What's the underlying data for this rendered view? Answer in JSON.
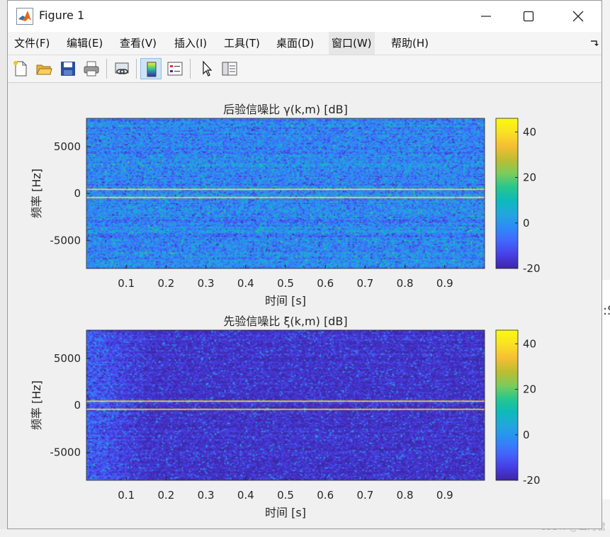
{
  "window": {
    "title": "Figure 1",
    "minimize_icon": "minimize-icon",
    "maximize_icon": "maximize-icon",
    "close_icon": "close-icon"
  },
  "menu": {
    "items": [
      {
        "label": "文件(F)"
      },
      {
        "label": "编辑(E)"
      },
      {
        "label": "查看(V)"
      },
      {
        "label": "插入(I)"
      },
      {
        "label": "工具(T)"
      },
      {
        "label": "桌面(D)"
      },
      {
        "label": "窗口(W)"
      },
      {
        "label": "帮助(H)"
      }
    ]
  },
  "toolbar": {
    "icons": [
      "new-figure-icon",
      "open-file-icon",
      "save-icon",
      "print-icon",
      "link-plot-icon",
      "colorbar-icon",
      "legend-icon",
      "edit-plot-icon",
      "property-inspector-icon"
    ]
  },
  "chart_data": [
    {
      "type": "heatmap",
      "title": "后验信噪比 γ(k,m) [dB]",
      "xlabel": "时间 [s]",
      "ylabel": "频率 [Hz]",
      "xlim": [
        0.0,
        1.0
      ],
      "ylim": [
        -8000,
        8000
      ],
      "xticks": [
        0.1,
        0.2,
        0.3,
        0.4,
        0.5,
        0.6,
        0.7,
        0.8,
        0.9
      ],
      "yticks": [
        -5000,
        0,
        5000
      ],
      "colorbar": {
        "ticks": [
          -20,
          0,
          20,
          40
        ],
        "range": [
          -20,
          46
        ],
        "colormap": "parula"
      },
      "background_level_db": -3,
      "noise_std_db": 6,
      "bright_lines_hz": [
        450,
        -450
      ],
      "bright_line_level_db": 42,
      "early_emphasis": false
    },
    {
      "type": "heatmap",
      "title": "先验信噪比 ξ(k,m) [dB]",
      "xlabel": "时间 [s]",
      "ylabel": "频率 [Hz]",
      "xlim": [
        0.0,
        1.0
      ],
      "ylim": [
        -8000,
        8000
      ],
      "xticks": [
        0.1,
        0.2,
        0.3,
        0.4,
        0.5,
        0.6,
        0.7,
        0.8,
        0.9
      ],
      "yticks": [
        -5000,
        0,
        5000
      ],
      "colorbar": {
        "ticks": [
          -20,
          0,
          20,
          40
        ],
        "range": [
          -20,
          46
        ],
        "colormap": "parula"
      },
      "background_level_db": -17,
      "noise_std_db": 3,
      "bright_lines_hz": [
        450,
        -450
      ],
      "bright_line_level_db": 40,
      "early_emphasis": true
    }
  ],
  "watermark": "CSDN @山河君"
}
